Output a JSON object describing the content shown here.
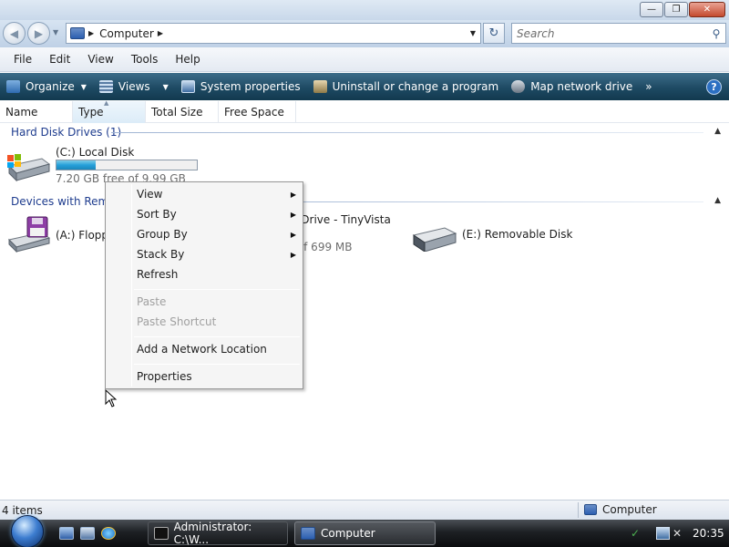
{
  "window": {
    "title": "Computer",
    "controls": {
      "minimize": "—",
      "maximize": "❐",
      "close": "✕"
    }
  },
  "nav": {
    "back_icon": "back-arrow-icon",
    "forward_icon": "forward-arrow-icon",
    "address_label": "Computer",
    "search_placeholder": "Search"
  },
  "menubar": {
    "items": [
      "File",
      "Edit",
      "View",
      "Tools",
      "Help"
    ]
  },
  "commandbar": {
    "items": [
      {
        "label": "Organize",
        "icon": "organize-icon",
        "dropdown": true
      },
      {
        "label": "Views",
        "icon": "views-icon",
        "dropdown": true
      },
      {
        "label": "System properties",
        "icon": "system-properties-icon",
        "dropdown": false
      },
      {
        "label": "Uninstall or change a program",
        "icon": "uninstall-program-icon",
        "dropdown": false
      },
      {
        "label": "Map network drive",
        "icon": "map-network-drive-icon",
        "dropdown": false
      }
    ],
    "overflow": "»",
    "help": "?"
  },
  "columns": [
    "Name",
    "Type",
    "Total Size",
    "Free Space"
  ],
  "groups": {
    "hard_disks": {
      "title": "Hard Disk Drives (1)",
      "drives": [
        {
          "name": "(C:) Local Disk",
          "free_text": "7.20 GB free of 9.99 GB",
          "used_fraction": 0.28
        }
      ]
    },
    "removable": {
      "title": "Devices with Removable Storage (3)",
      "drives": [
        {
          "name": "(A:) Floppy Disk Drive"
        },
        {
          "name": "(D:) DVD RW Drive - TinyVista",
          "free_text": "0 bytes free of 699 MB"
        },
        {
          "name": "(E:) Removable Disk"
        }
      ]
    }
  },
  "context_menu": {
    "items": [
      {
        "label": "View",
        "submenu": true,
        "enabled": true
      },
      {
        "label": "Sort By",
        "submenu": true,
        "enabled": true
      },
      {
        "label": "Group By",
        "submenu": true,
        "enabled": true
      },
      {
        "label": "Stack By",
        "submenu": true,
        "enabled": true
      },
      {
        "label": "Refresh",
        "submenu": false,
        "enabled": true
      },
      {
        "label": "Paste",
        "submenu": false,
        "enabled": false
      },
      {
        "label": "Paste Shortcut",
        "submenu": false,
        "enabled": false
      },
      {
        "label": "Add a Network Location",
        "submenu": false,
        "enabled": true
      },
      {
        "label": "Properties",
        "submenu": false,
        "enabled": true
      }
    ]
  },
  "statusbar": {
    "item_count": "4 items",
    "location": "Computer"
  },
  "taskbar": {
    "tasks": [
      {
        "label": "Administrator: C:\\W...",
        "active": false
      },
      {
        "label": "Computer",
        "active": true
      }
    ],
    "clock": "20:35"
  }
}
